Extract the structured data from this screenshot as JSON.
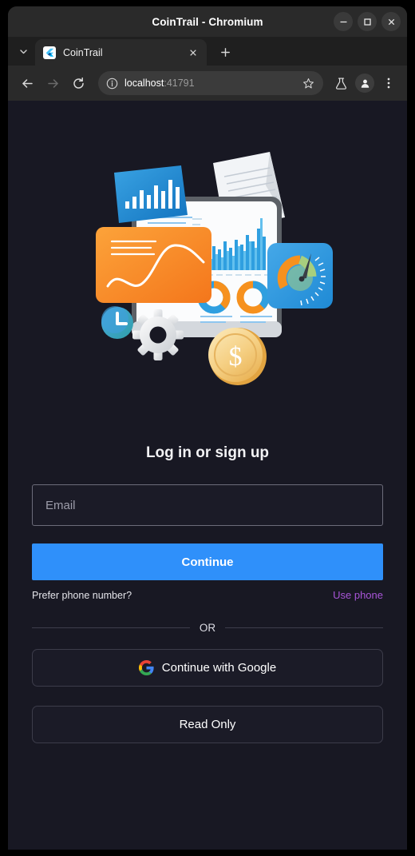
{
  "window": {
    "title": "CoinTrail - Chromium",
    "controls": {
      "minimize": "minimize-button",
      "maximize": "maximize-button",
      "close": "close-button"
    }
  },
  "tabstrip": {
    "tab_list_label": "chevron-down-icon",
    "tabs": [
      {
        "title": "CoinTrail",
        "favicon": "flutter-icon",
        "close_label": "×",
        "active": true
      }
    ],
    "new_tab_label": "+"
  },
  "toolbar": {
    "back_label": "←",
    "forward_label": "→",
    "reload_label": "⟳",
    "site_info_icon": "info-icon",
    "url_host": "localhost",
    "url_port": ":41791",
    "url_full": "localhost:41791",
    "bookmark_label": "bookmark-star-icon",
    "experiments_label": "flask-icon",
    "profile_label": "profile-avatar-icon",
    "menu_label": "three-dot-menu-icon"
  },
  "page": {
    "background": "#181823",
    "hero": {
      "alt": "analytics dashboard illustration",
      "elements": [
        "tablet-dashboard",
        "blue-bar-chart-card",
        "orange-line-chart-card",
        "blue-gauge-card",
        "document-sheet",
        "clock-sphere",
        "gear",
        "dollar-coin"
      ]
    },
    "auth": {
      "title": "Log in or sign up",
      "email_placeholder": "Email",
      "email_value": "",
      "continue_label": "Continue",
      "prefer_phone_text": "Prefer phone number?",
      "use_phone_label": "Use phone",
      "divider_label": "OR",
      "google_label": "Continue with Google",
      "read_only_label": "Read Only"
    }
  },
  "colors": {
    "accent_blue": "#2f90fa",
    "link_purple": "#a855d8",
    "page_bg": "#181823",
    "chrome_bg": "#2a2a2a",
    "tabstrip_bg": "#1f1f1f"
  }
}
